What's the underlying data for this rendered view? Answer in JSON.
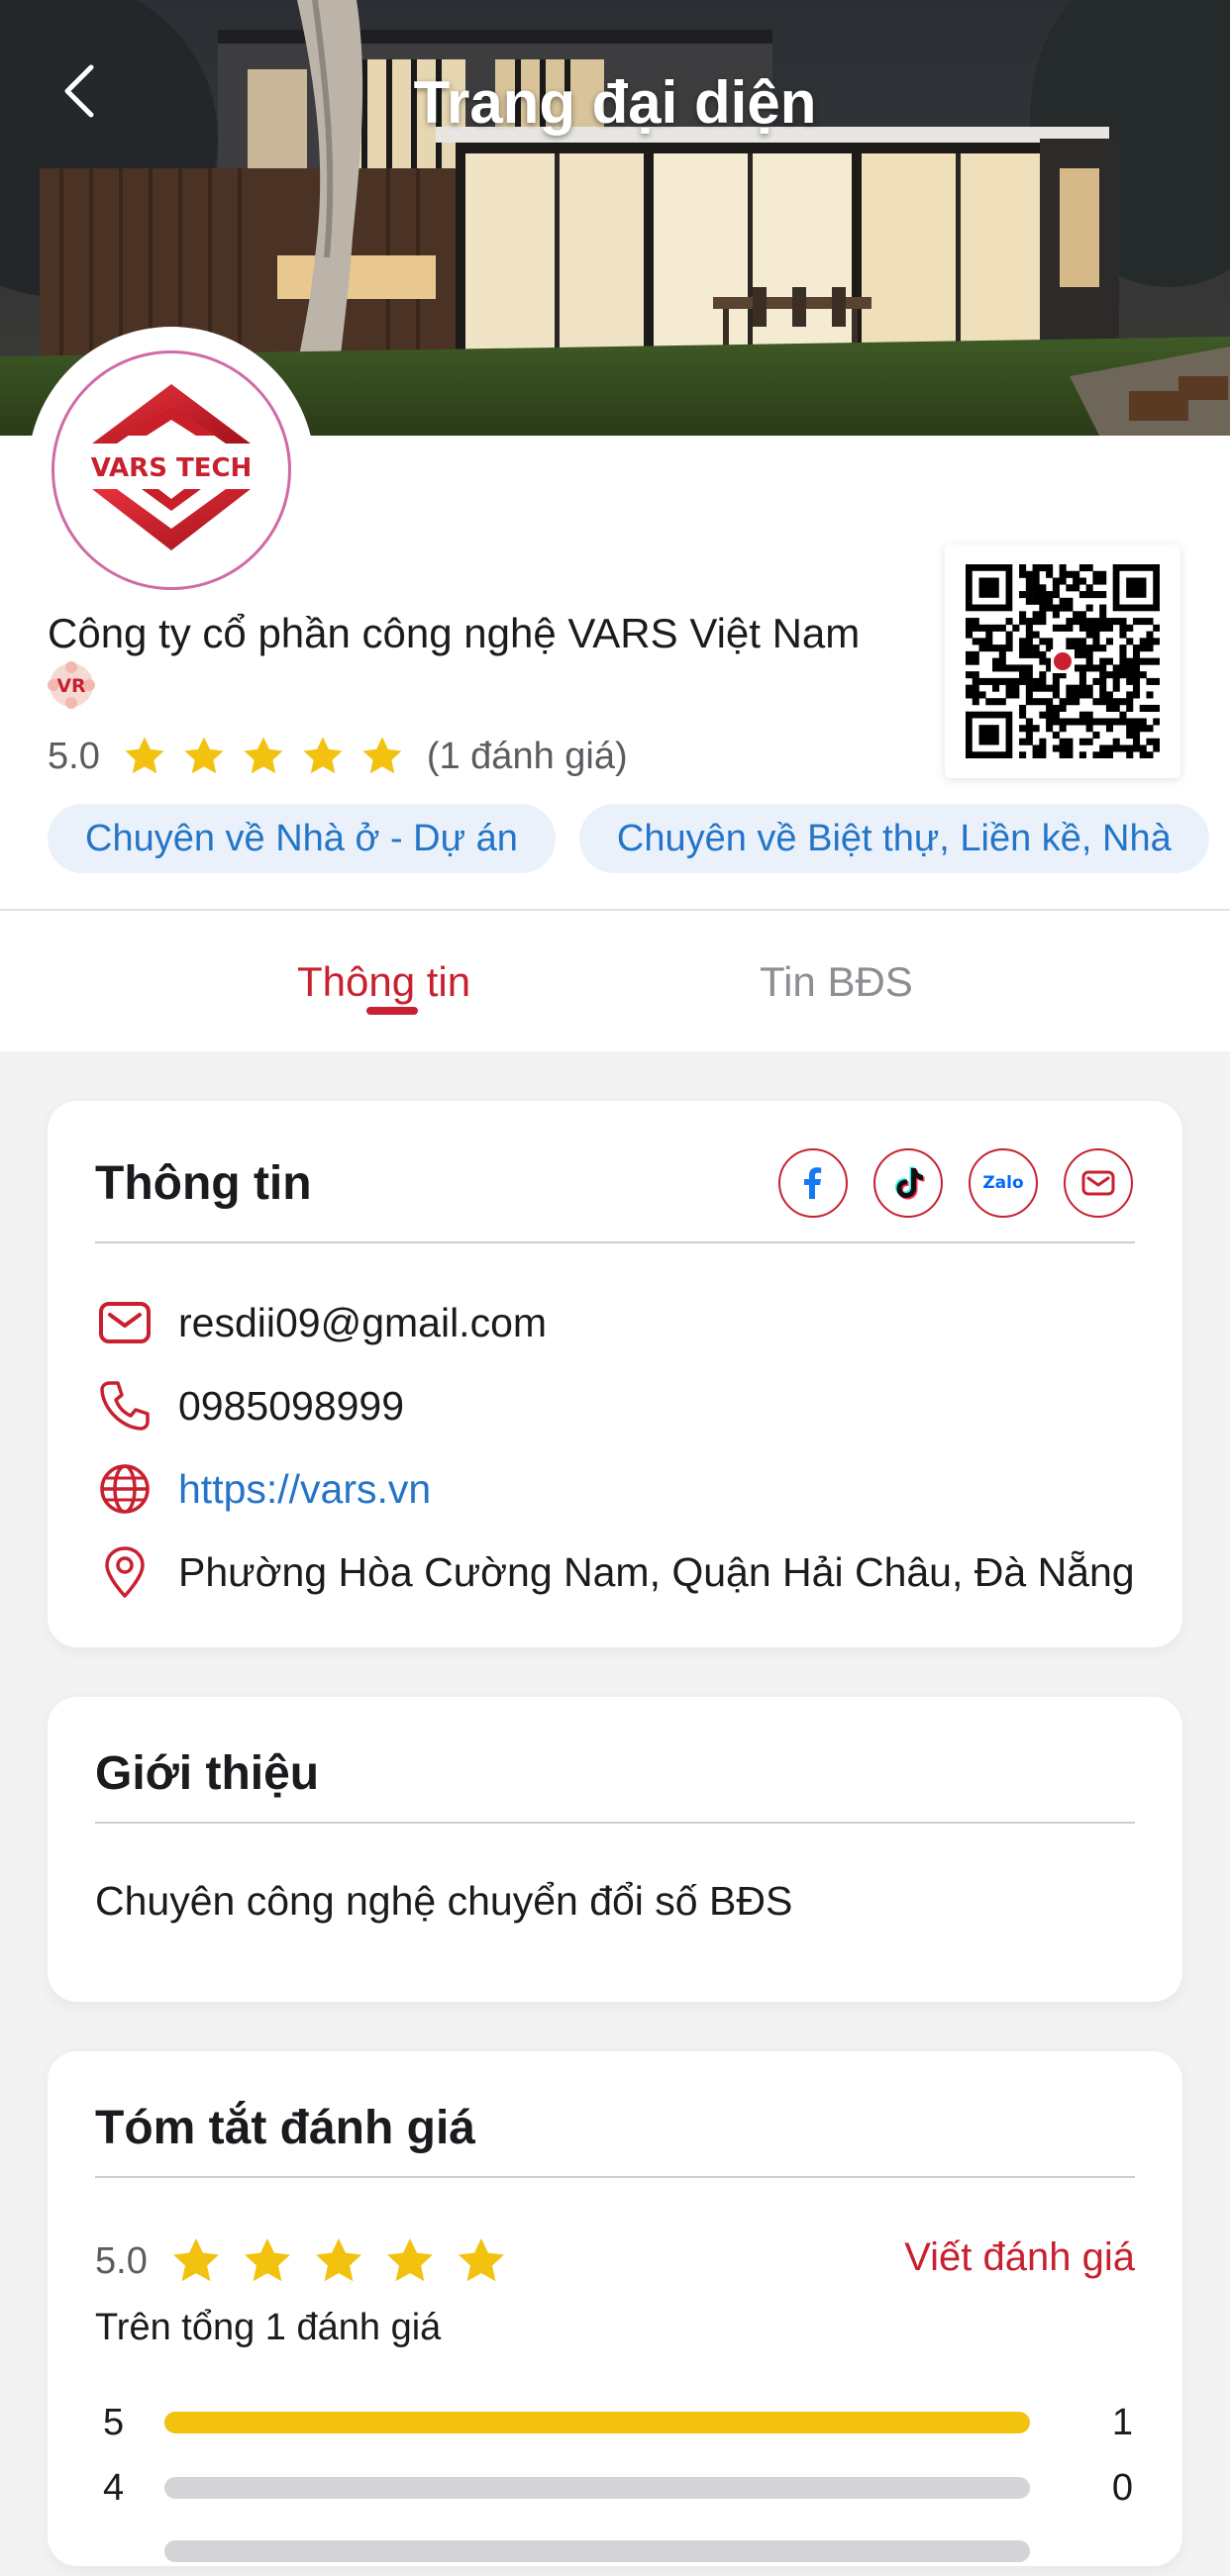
{
  "header": {
    "title": "Trang đại diện",
    "back_icon": "chevron-left-icon"
  },
  "profile": {
    "logo_text": "VARS TECH",
    "company_name": "Công ty cổ phần công nghệ VARS Việt Nam",
    "badge_text": "VR",
    "rating_value": "5.0",
    "rating_stars": 5,
    "rating_count_text": "(1 đánh giá)",
    "chips": [
      "Chuyên về Nhà ở - Dự án",
      "Chuyên về Biệt thự, Liền kề, Nhà"
    ]
  },
  "tabs": [
    {
      "label": "Thông tin",
      "active": true
    },
    {
      "label": "Tin BĐS",
      "active": false
    }
  ],
  "info_card": {
    "title": "Thông tin",
    "socials": [
      "facebook-icon",
      "tiktok-icon",
      "zalo-icon",
      "mail-icon"
    ],
    "zalo_label": "Zalo",
    "email": "resdii09@gmail.com",
    "phone": "0985098999",
    "website": "https://vars.vn",
    "address": "Phường Hòa Cường Nam, Quận Hải Châu, Đà Nẵng"
  },
  "intro_card": {
    "title": "Giới thiệu",
    "text": "Chuyên công nghệ chuyển đổi số BĐS"
  },
  "summary_card": {
    "title": "Tóm tắt đánh giá",
    "rating_value": "5.0",
    "rating_stars": 5,
    "write_review_label": "Viết đánh giá",
    "total_text": "Trên tổng 1 đánh giá",
    "bars": [
      {
        "star": "5",
        "count": "1",
        "fraction": 1.0
      },
      {
        "star": "4",
        "count": "0",
        "fraction": 0.0
      }
    ]
  },
  "colors": {
    "accent": "#c8202f",
    "link": "#2475c8",
    "star": "#f2c20f",
    "chip_bg": "#eaf1fb"
  }
}
